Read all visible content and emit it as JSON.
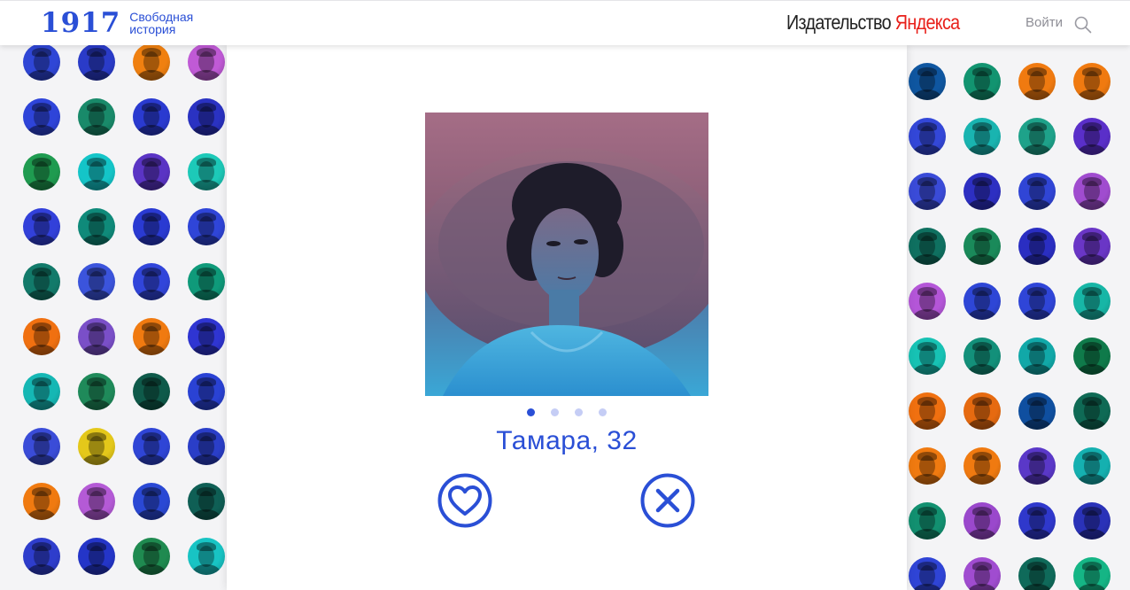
{
  "header": {
    "logo_year": "1917",
    "logo_line1": "Свободная",
    "logo_line2": "история",
    "publisher_prefix": "Издательство ",
    "publisher_brand": "Яндекса",
    "login_label": "Войти",
    "search_icon": "search-icon"
  },
  "profile": {
    "name_age": "Тамара, 32",
    "photo_count": 4,
    "active_photo": 1,
    "like_icon": "heart-icon",
    "dislike_icon": "close-icon"
  },
  "colors": {
    "accent": "#2a4fd6",
    "brand_red": "#e8201a",
    "avatar_tints": [
      "#2845d8",
      "#1e9f6e",
      "#f07a10",
      "#b85bd8",
      "#19c9d4",
      "#e4c81a",
      "#5a2fc9",
      "#0f5f7a"
    ]
  },
  "left_avatars": [
    [
      "#2f46d6",
      "#2a3bc8",
      "#f08010",
      "#c05ad6"
    ],
    [
      "#2e44d9",
      "#198a6a",
      "#2a3ad0",
      "#2a32c2"
    ],
    [
      "#1f9b50",
      "#14c5c8",
      "#5a34c4",
      "#1dc9b8"
    ],
    [
      "#3240da",
      "#0f8a7a",
      "#2a3ad2",
      "#2f45d8"
    ],
    [
      "#127a6a",
      "#3b54dc",
      "#3145da",
      "#0f9a7a"
    ],
    [
      "#f07010",
      "#7a4fc8",
      "#f07a10",
      "#2f35d2"
    ],
    [
      "#15b7b4",
      "#1f8a5a",
      "#0f5a4a",
      "#2a42d4"
    ],
    [
      "#3a4cd8",
      "#e4c81a",
      "#2f45d6",
      "#2a3ec8"
    ],
    [
      "#f07a10",
      "#b45ad6",
      "#2a48d4",
      "#0f5f55"
    ],
    [
      "#2e3dcc",
      "#2435c8",
      "#1f8a50",
      "#18c4c4"
    ]
  ],
  "right_avatars": [
    [
      "#0f56a0",
      "#129470",
      "#f07a10",
      "#f07a10"
    ],
    [
      "#3347d8",
      "#19b4b0",
      "#1ea28a",
      "#5a2fc9"
    ],
    [
      "#3a4bd8",
      "#2d2fc2",
      "#3045d6",
      "#a04ccf"
    ],
    [
      "#0f7060",
      "#1a8a5a",
      "#2a2ec2",
      "#6a36c6"
    ],
    [
      "#b456d8",
      "#2e46d6",
      "#2f45d8",
      "#17b6a6"
    ],
    [
      "#17c2b4",
      "#13907a",
      "#11a8a8",
      "#0f7a4a"
    ],
    [
      "#f07010",
      "#e66a10",
      "#0f4fa0",
      "#0f6a55"
    ],
    [
      "#f07a10",
      "#f07a10",
      "#5a38c8",
      "#15b0b0"
    ],
    [
      "#129070",
      "#9a48cc",
      "#2f38cc",
      "#2a32b8"
    ],
    [
      "#2f44d6",
      "#a04cd0",
      "#0f6a5a",
      "#15b585"
    ]
  ]
}
